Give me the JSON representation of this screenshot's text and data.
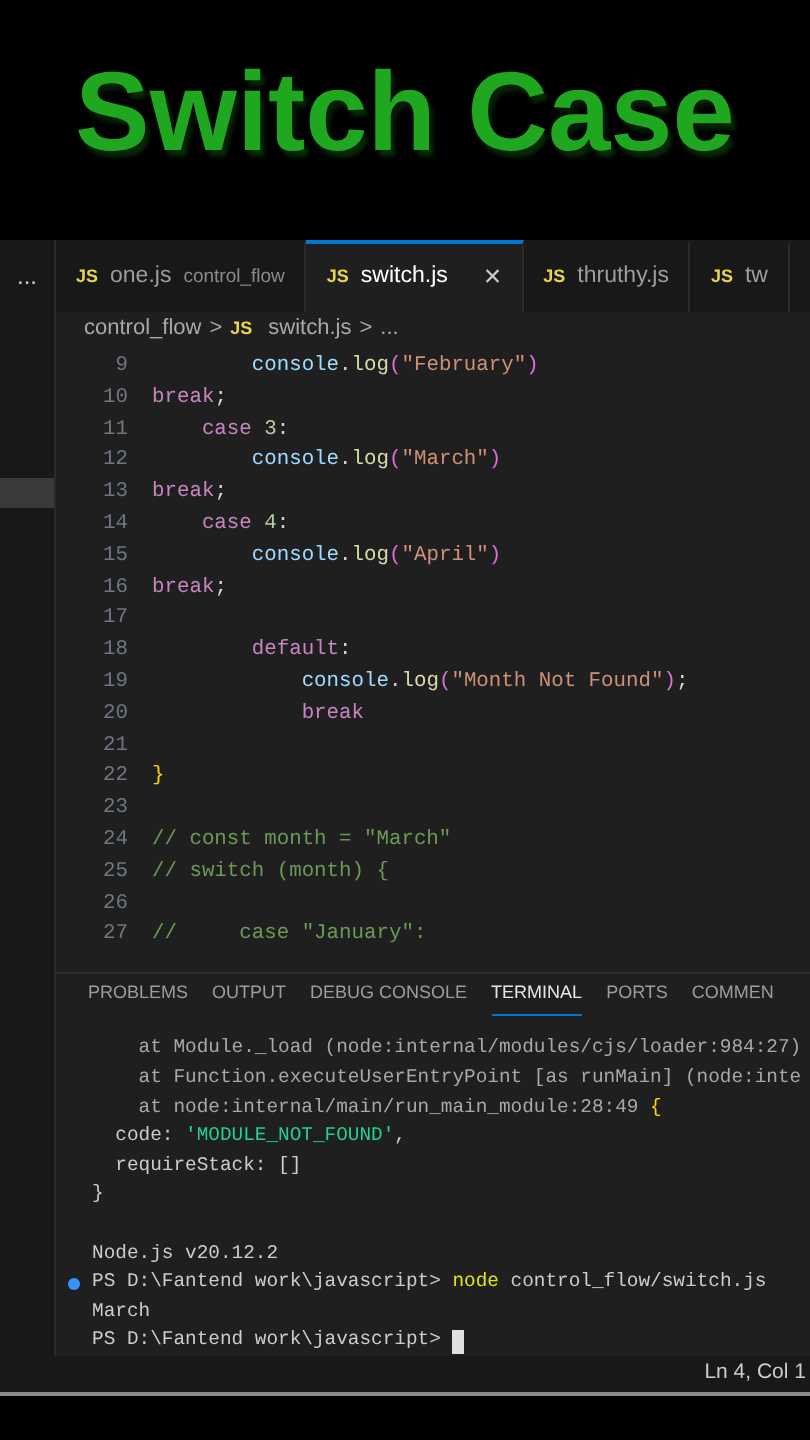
{
  "banner": {
    "title": "Switch Case"
  },
  "sidebar": {
    "more": "..."
  },
  "tabs": [
    {
      "label": "one.js",
      "description": "control_flow",
      "badge": "JS",
      "selected": false
    },
    {
      "label": "switch.js",
      "badge": "JS",
      "selected": true,
      "close": "×"
    },
    {
      "label": "thruthy.js",
      "badge": "JS",
      "selected": false
    },
    {
      "label": "tw",
      "badge": "JS",
      "selected": false
    }
  ],
  "breadcrumb": [
    {
      "label": "control_flow"
    },
    {
      "label": "switch.js",
      "badge": "JS"
    },
    {
      "label": "..."
    }
  ],
  "breadcrumb_separator": ">",
  "code": [
    {
      "number": "9",
      "tokens": [
        {
          "text": "        console",
          "kind": "var"
        },
        {
          "text": ".",
          "kind": "plain"
        },
        {
          "text": "log",
          "kind": "fn"
        },
        {
          "text": "(",
          "kind": "paren"
        },
        {
          "text": "\"February\"",
          "kind": "string"
        },
        {
          "text": ")",
          "kind": "paren"
        }
      ]
    },
    {
      "number": "10",
      "tokens": [
        {
          "text": "break",
          "kind": "keyword"
        },
        {
          "text": ";",
          "kind": "plain"
        }
      ]
    },
    {
      "number": "11",
      "tokens": [
        {
          "text": "    case",
          "kind": "keyword"
        },
        {
          "text": " 3",
          "kind": "number"
        },
        {
          "text": ":",
          "kind": "plain"
        }
      ]
    },
    {
      "number": "12",
      "tokens": [
        {
          "text": "        console",
          "kind": "var"
        },
        {
          "text": ".",
          "kind": "plain"
        },
        {
          "text": "log",
          "kind": "fn"
        },
        {
          "text": "(",
          "kind": "paren"
        },
        {
          "text": "\"March\"",
          "kind": "string"
        },
        {
          "text": ")",
          "kind": "paren"
        }
      ]
    },
    {
      "number": "13",
      "tokens": [
        {
          "text": "break",
          "kind": "keyword"
        },
        {
          "text": ";",
          "kind": "plain"
        }
      ]
    },
    {
      "number": "14",
      "tokens": [
        {
          "text": "    case",
          "kind": "keyword"
        },
        {
          "text": " 4",
          "kind": "number"
        },
        {
          "text": ":",
          "kind": "plain"
        }
      ]
    },
    {
      "number": "15",
      "tokens": [
        {
          "text": "        console",
          "kind": "var"
        },
        {
          "text": ".",
          "kind": "plain"
        },
        {
          "text": "log",
          "kind": "fn"
        },
        {
          "text": "(",
          "kind": "paren"
        },
        {
          "text": "\"April\"",
          "kind": "string"
        },
        {
          "text": ")",
          "kind": "paren"
        }
      ]
    },
    {
      "number": "16",
      "tokens": [
        {
          "text": "break",
          "kind": "keyword"
        },
        {
          "text": ";",
          "kind": "plain"
        }
      ]
    },
    {
      "number": "17"
    },
    {
      "number": "18",
      "tokens": [
        {
          "text": "        default",
          "kind": "keyword"
        },
        {
          "text": ":",
          "kind": "plain"
        }
      ]
    },
    {
      "number": "19",
      "tokens": [
        {
          "text": "            console",
          "kind": "var"
        },
        {
          "text": ".",
          "kind": "plain"
        },
        {
          "text": "log",
          "kind": "fn"
        },
        {
          "text": "(",
          "kind": "paren"
        },
        {
          "text": "\"Month Not Found\"",
          "kind": "string"
        },
        {
          "text": ")",
          "kind": "paren"
        },
        {
          "text": ";",
          "kind": "plain"
        }
      ]
    },
    {
      "number": "20",
      "tokens": [
        {
          "text": "            break",
          "kind": "keyword"
        }
      ]
    },
    {
      "number": "21"
    },
    {
      "number": "22",
      "tokens": [
        {
          "text": "}",
          "kind": "brace"
        }
      ]
    },
    {
      "number": "23"
    },
    {
      "number": "24",
      "tokens": [
        {
          "text": "// const month = \"March\"",
          "kind": "comment"
        }
      ]
    },
    {
      "number": "25",
      "tokens": [
        {
          "text": "// switch (month) {",
          "kind": "comment"
        }
      ]
    },
    {
      "number": "26"
    },
    {
      "number": "27",
      "tokens": [
        {
          "text": "//     case \"January\":",
          "kind": "comment"
        }
      ]
    }
  ],
  "panel_tabs": [
    {
      "label": "PROBLEMS",
      "selected": false
    },
    {
      "label": "OUTPUT",
      "selected": false
    },
    {
      "label": "DEBUG CONSOLE",
      "selected": false
    },
    {
      "label": "TERMINAL",
      "selected": true
    },
    {
      "label": "PORTS",
      "selected": false
    },
    {
      "label": "COMMEN",
      "selected": false
    }
  ],
  "terminal": [
    {
      "dot": false,
      "cursor": false,
      "tokens": [
        {
          "text": "    at Module._load (node:internal/modules/cjs/loader:984:27)",
          "kind": "dim"
        }
      ]
    },
    {
      "dot": false,
      "cursor": false,
      "tokens": [
        {
          "text": "    at Function.executeUserEntryPoint [as runMain] (node:inte",
          "kind": "dim"
        }
      ]
    },
    {
      "dot": false,
      "cursor": false,
      "tokens": [
        {
          "text": "    at node:internal/main/run_main_module:28:49 ",
          "kind": "dim"
        },
        {
          "text": "{",
          "kind": "brace"
        }
      ]
    },
    {
      "dot": false,
      "cursor": false,
      "tokens": [
        {
          "text": "  code: ",
          "kind": "plain"
        },
        {
          "text": "'MODULE_NOT_FOUND'",
          "kind": "string"
        },
        {
          "text": ",",
          "kind": "plain"
        }
      ]
    },
    {
      "dot": false,
      "cursor": false,
      "tokens": [
        {
          "text": "  requireStack: []",
          "kind": "plain"
        }
      ]
    },
    {
      "dot": false,
      "cursor": false,
      "tokens": [
        {
          "text": "}",
          "kind": "plain"
        }
      ]
    },
    {
      "dot": false,
      "cursor": false
    },
    {
      "dot": false,
      "cursor": false,
      "tokens": [
        {
          "text": "Node.js v20.12.2",
          "kind": "plain"
        }
      ]
    },
    {
      "dot": true,
      "cursor": false,
      "tokens": [
        {
          "text": "PS D:\\Fantend work\\javascript> ",
          "kind": "plain"
        },
        {
          "text": "node",
          "kind": "command"
        },
        {
          "text": " control_flow/switch.js",
          "kind": "plain"
        }
      ]
    },
    {
      "dot": false,
      "cursor": false,
      "tokens": [
        {
          "text": "March",
          "kind": "plain"
        }
      ]
    },
    {
      "dot": false,
      "cursor": true,
      "tokens": [
        {
          "text": "PS D:\\Fantend work\\javascript> ",
          "kind": "plain"
        }
      ]
    }
  ],
  "status_bar": {
    "position": "Ln 4, Col 1"
  }
}
